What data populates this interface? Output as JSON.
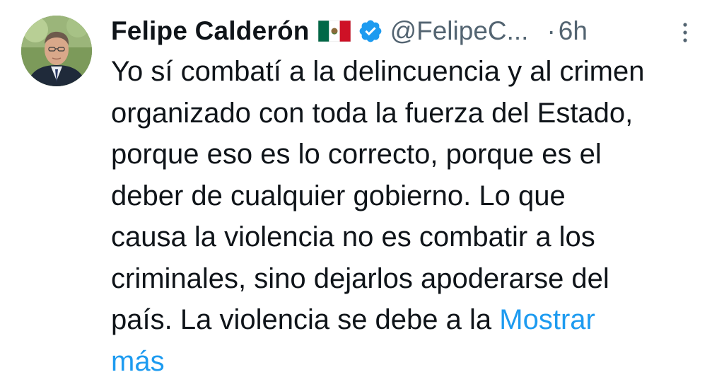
{
  "tweet": {
    "author": {
      "name": "Felipe Calderón",
      "handle": "@FelipeC...",
      "flag_emoji": "🇲🇽",
      "verified": true
    },
    "separator": "·",
    "time": "6h",
    "text_lines": [
      "Yo sí combatí a la delincuencia y al crimen",
      "organizado con toda la fuerza del Estado,",
      "porque eso es lo correcto, porque es el",
      "deber de cualquier gobierno. Lo que",
      "causa la violencia no es combatir a los",
      "criminales, sino dejarlos apoderarse del",
      "país. La violencia se debe a la "
    ],
    "show_more_part1": "Mostrar",
    "show_more_part2": "más"
  },
  "colors": {
    "text": "#0f1419",
    "secondary": "#536471",
    "link": "#1d9bf0",
    "verified_badge": "#1d9bf0",
    "background": "#ffffff"
  },
  "icons": {
    "verified": "verified-badge-icon",
    "flag": "mexico-flag-icon",
    "more": "more-options-icon"
  }
}
